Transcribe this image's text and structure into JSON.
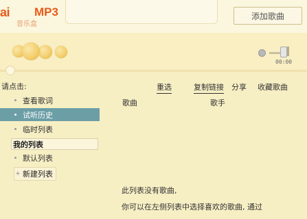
{
  "header": {
    "logo_main": "ai",
    "logo_mp3": "MP3",
    "logo_sub": "音乐盒",
    "add_song_label": "添加歌曲"
  },
  "player": {
    "time": "00:00"
  },
  "left_pane": {
    "prompt": "请点击:",
    "items": [
      {
        "label": "查看歌词"
      },
      {
        "label": "试听历史",
        "selected": true
      },
      {
        "label": "临时列表"
      }
    ],
    "my_lists_title": "我的列表",
    "default_list": "默认列表",
    "new_list": "新建列表"
  },
  "toolbar": {
    "reselect": "重选",
    "copy_link": "复制链接",
    "share": "分享",
    "collect": "收藏歌曲"
  },
  "song_table": {
    "columns": [
      "歌曲",
      "歌手"
    ],
    "rows": []
  },
  "empty_state": {
    "line1": "此列表没有歌曲,",
    "line2": "你可以在左侧列表中选择喜欢的歌曲, 通过"
  },
  "colors": {
    "background": "#f7efc4",
    "selected_item": "#6c9ea6",
    "logo": "#e65b1a"
  }
}
